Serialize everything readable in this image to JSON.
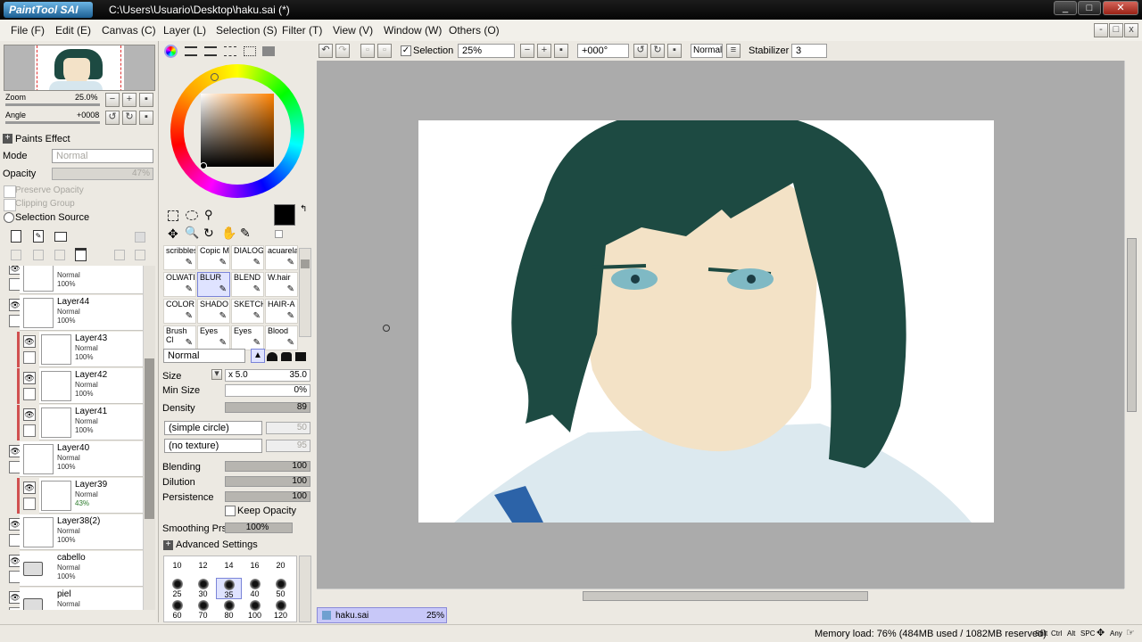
{
  "window": {
    "logo": "PaintTool SAI",
    "title": "C:\\Users\\Usuario\\Desktop\\haku.sai (*)"
  },
  "menu": [
    "File (F)",
    "Edit (E)",
    "Canvas (C)",
    "Layer (L)",
    "Selection (S)",
    "Filter (T)",
    "View (V)",
    "Window (W)",
    "Others (O)"
  ],
  "navigator": {
    "zoom_label": "Zoom",
    "zoom_value": "25.0%",
    "angle_label": "Angle",
    "angle_value": "+0008"
  },
  "layer_props": {
    "paints_effect": "Paints Effect",
    "mode_label": "Mode",
    "mode_value": "Normal",
    "opacity_label": "Opacity",
    "opacity_value": "47%",
    "preserve_opacity": "Preserve Opacity",
    "clipping_group": "Clipping Group",
    "selection_source": "Selection Source"
  },
  "layers": [
    {
      "name": "",
      "mode": "Normal",
      "opacity": "100%",
      "indent": false,
      "clip": false
    },
    {
      "name": "Layer44",
      "mode": "Normal",
      "opacity": "100%",
      "indent": false,
      "clip": false
    },
    {
      "name": "Layer43",
      "mode": "Normal",
      "opacity": "100%",
      "indent": true,
      "clip": true
    },
    {
      "name": "Layer42",
      "mode": "Normal",
      "opacity": "100%",
      "indent": true,
      "clip": true
    },
    {
      "name": "Layer41",
      "mode": "Normal",
      "opacity": "100%",
      "indent": true,
      "clip": true
    },
    {
      "name": "Layer40",
      "mode": "Normal",
      "opacity": "100%",
      "indent": false,
      "clip": false
    },
    {
      "name": "Layer39",
      "mode": "Normal",
      "opacity": "43%",
      "indent": true,
      "clip": true
    },
    {
      "name": "Layer38(2)",
      "mode": "Normal",
      "opacity": "100%",
      "indent": false,
      "clip": false
    },
    {
      "name": "cabello",
      "mode": "Normal",
      "opacity": "100%",
      "indent": false,
      "clip": false,
      "folder": true
    },
    {
      "name": "piel",
      "mode": "Normal",
      "opacity": "",
      "indent": false,
      "clip": false,
      "folder": true
    }
  ],
  "brushes": [
    [
      "scribbles",
      "Copic M",
      "DIALOG",
      "acuarela"
    ],
    [
      "OLWATI",
      "BLUR",
      "BLEND",
      "W.hair"
    ],
    [
      "COLOR",
      "SHADO",
      "SKETCH",
      "HAIR-A"
    ],
    [
      "Brush Cl",
      "Eyes",
      "Eyes",
      "Blood"
    ]
  ],
  "brush_settings": {
    "mode": "Normal",
    "size_label": "Size",
    "size_mult": "x 5.0",
    "size_value": "35.0",
    "minsize_label": "Min Size",
    "minsize_value": "0%",
    "density_label": "Density",
    "density_value": "89",
    "shape": "(simple circle)",
    "shape_value": "50",
    "texture": "(no texture)",
    "texture_value": "95",
    "blending_label": "Blending",
    "blending_value": "100",
    "dilution_label": "Dilution",
    "dilution_value": "100",
    "persistence_label": "Persistence",
    "persistence_value": "100",
    "keep_opacity": "Keep Opacity",
    "smoothing_label": "Smoothing Prs",
    "smoothing_value": "100%",
    "advanced": "Advanced Settings"
  },
  "brush_sizes": {
    "row1": [
      "10",
      "12",
      "14",
      "16",
      "20"
    ],
    "row2": [
      "25",
      "30",
      "35",
      "40",
      "50"
    ],
    "row3": [
      "60",
      "70",
      "80",
      "100",
      "120"
    ]
  },
  "toolbar": {
    "selection": "Selection",
    "zoom": "25%",
    "angle": "+000°",
    "blend": "Normal",
    "stabilizer_label": "Stabilizer",
    "stabilizer_value": "3"
  },
  "tab": {
    "name": "haku.sai",
    "zoom": "25%"
  },
  "status": {
    "memory": "Memory load: 76% (484MB used / 1082MB reserved)",
    "keys": [
      "Shft",
      "Ctrl",
      "Alt",
      "SPC",
      "Any"
    ]
  },
  "colors": {
    "primary": "#000000",
    "secondary": "#dce6ff",
    "accent": "#a8a8f0",
    "hair": "#1d4a42"
  }
}
